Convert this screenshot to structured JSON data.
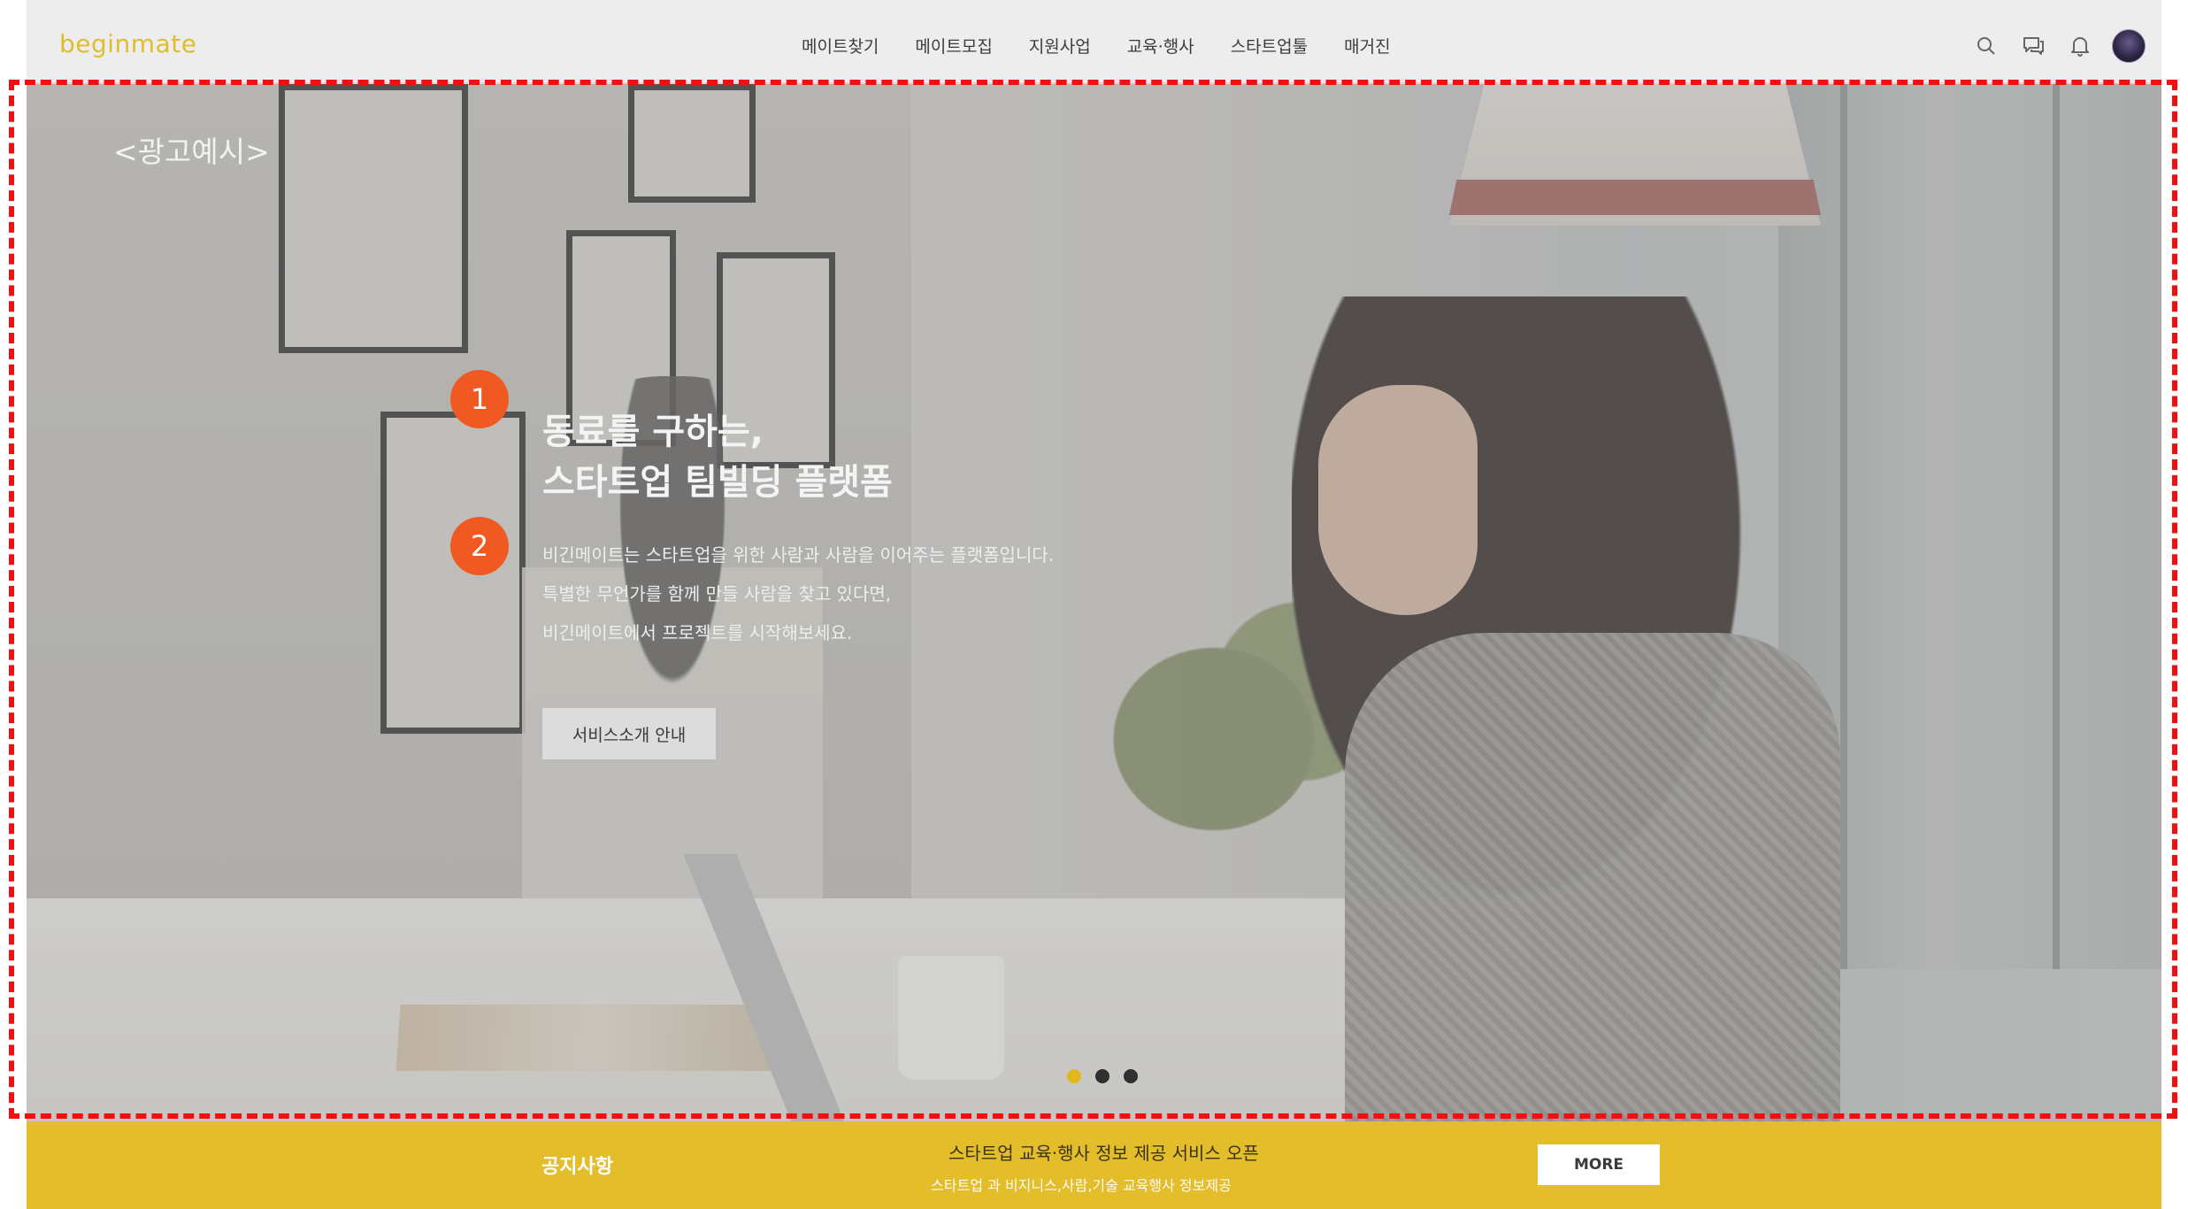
{
  "header": {
    "logo": "beginmate",
    "nav": [
      "메이트찾기",
      "메이트모집",
      "지원사업",
      "교육·행사",
      "스타트업툴",
      "매거진"
    ],
    "icons": [
      "search-icon",
      "chat-icon",
      "bell-icon"
    ]
  },
  "hero": {
    "ad_label": "<광고예시>",
    "markers": [
      "1",
      "2"
    ],
    "headline": [
      "동료를 구하는,",
      "스타트업 팀빌딩 플랫폼"
    ],
    "description": [
      "비긴메이트는 스타트업을 위한 사람과 사람을 이어주는 플랫폼입니다.",
      "특별한 무언가를 함께 만들 사람을 찾고 있다면,",
      "비긴메이트에서 프로젝트를 시작해보세요."
    ],
    "service_button": "서비스소개 안내",
    "slides": {
      "count": 3,
      "active_index": 0
    }
  },
  "notice": {
    "title": "공지사항",
    "headline": "스타트업 교육·행사 정보 제공 서비스 오픈",
    "subtext": "스타트업 과 비지니스,사람,기술 교육행사 정보제공",
    "more_button": "MORE"
  },
  "colors": {
    "brand_yellow": "#e3bd2a",
    "marker_orange": "#f05a22",
    "annotation_red": "#ee1111",
    "dot_active": "#e0b721",
    "dot_inactive": "#2f2f2f"
  }
}
